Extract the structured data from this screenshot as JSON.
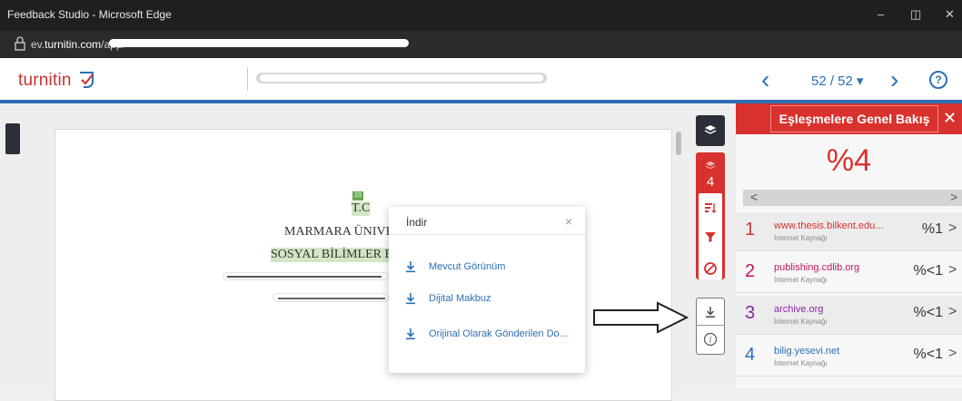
{
  "window": {
    "title": "Feedback Studio - Microsoft Edge",
    "minimize": "–",
    "restore": "◫",
    "close": "✕"
  },
  "address_bar": {
    "url_prefix": "ev.",
    "url_host": "turnitin.com",
    "url_path": "/app/"
  },
  "app": {
    "logo": "turnitin",
    "page_indicator": "52 / 52 ▾",
    "prev_label": "‹",
    "next_label": "›",
    "help_label": "?"
  },
  "document": {
    "match_number": "23",
    "line1": "T.C",
    "line2": "MARMARA ÜNIVE",
    "line3": "SOSYAL BİLİMLER E"
  },
  "toolbar": {
    "match_count": "4"
  },
  "panel": {
    "title": "Eşleşmelere Genel Bakış",
    "close": "✕",
    "score": "%4",
    "scroll_left": "<",
    "scroll_right": ">",
    "matches": [
      {
        "num": "1",
        "source": "www.thesis.bilkent.edu...",
        "type": "İnternet Kaynağı",
        "pct": "%1",
        "color": "#d8312e"
      },
      {
        "num": "2",
        "source": "publishing.cdlib.org",
        "type": "İnternet Kaynağı",
        "pct": "%<1",
        "color": "#c2185b"
      },
      {
        "num": "3",
        "source": "archive.org",
        "type": "İnternet Kaynağı",
        "pct": "%<1",
        "color": "#8e24aa"
      },
      {
        "num": "4",
        "source": "bilig.yesevi.net",
        "type": "İnternet Kaynağı",
        "pct": "%<1",
        "color": "#2d6fb5"
      }
    ]
  },
  "dialog": {
    "title": "İndir",
    "close": "×",
    "items": [
      {
        "label": "Mevcut Görünüm"
      },
      {
        "label": "Dijital Makbuz"
      },
      {
        "label": "Orijinal Olarak Gönderilen Do..."
      }
    ]
  }
}
